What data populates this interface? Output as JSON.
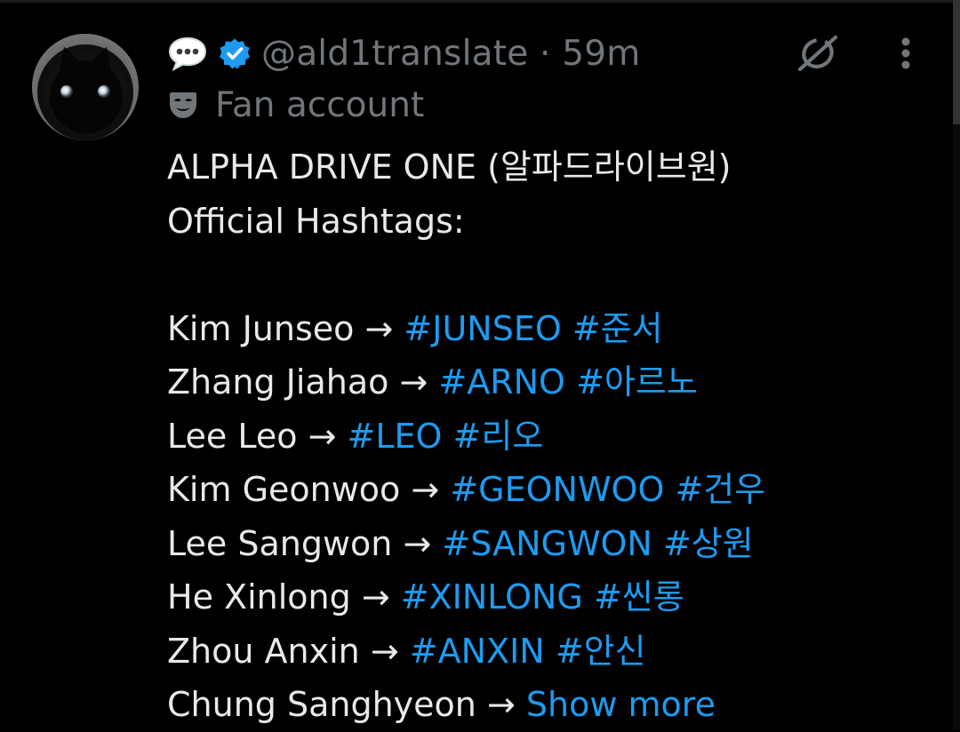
{
  "post": {
    "handle": "@ald1translate",
    "separator": "·",
    "time": "59m",
    "account_label": "Fan account",
    "title_line": "ALPHA DRIVE ONE (알파드라이브원)",
    "subtitle_line": "Official Hashtags:",
    "members": [
      {
        "name": "Kim Junseo",
        "arrow": "→",
        "tag_en": "#JUNSEO",
        "tag_ko": "#준서"
      },
      {
        "name": "Zhang Jiahao",
        "arrow": "→",
        "tag_en": "#ARNO",
        "tag_ko": "#아르노"
      },
      {
        "name": "Lee Leo",
        "arrow": "→",
        "tag_en": "#LEO",
        "tag_ko": "#리오"
      },
      {
        "name": "Kim Geonwoo",
        "arrow": "→",
        "tag_en": "#GEONWOO",
        "tag_ko": "#건우"
      },
      {
        "name": "Lee Sangwon",
        "arrow": "→",
        "tag_en": "#SANGWON",
        "tag_ko": "#상원"
      },
      {
        "name": "He Xinlong",
        "arrow": "→",
        "tag_en": "#XINLONG",
        "tag_ko": "#씬롱"
      },
      {
        "name": "Zhou Anxin",
        "arrow": "→",
        "tag_en": "#ANXIN",
        "tag_ko": "#안신"
      }
    ],
    "last_line": {
      "name": "Chung Sanghyeon",
      "arrow": "→"
    },
    "show_more": "Show more"
  },
  "icons": {
    "emoji": "speech-bubble-icon",
    "verified": "verified-badge-icon",
    "grok": "grok-icon",
    "more": "more-options-icon",
    "account_label": "mask-icon"
  },
  "colors": {
    "background": "#000000",
    "text": "#e7e9ea",
    "muted": "#71767b",
    "link": "#1d9bf0",
    "verified": "#1d9bf0"
  }
}
